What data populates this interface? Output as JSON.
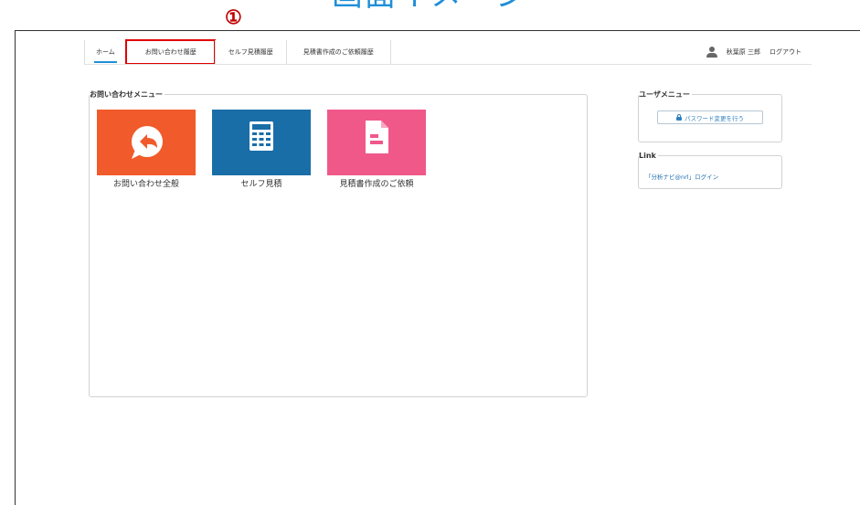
{
  "header": {
    "screen_title": "画面イメージ",
    "annotation_number": "①"
  },
  "nav": {
    "tabs": [
      {
        "label": "ホーム",
        "active": true
      },
      {
        "label": "お問い合わせ履歴",
        "highlighted": true
      },
      {
        "label": "セルフ見積履歴"
      },
      {
        "label": "見積書作成のご依頼履歴"
      }
    ],
    "user_name": "秋葉原 三郎",
    "logout_label": "ログアウト"
  },
  "inquiry_menu": {
    "title": "お問い合わせメニュー",
    "tiles": [
      {
        "label": "お問い合わせ全般",
        "icon": "reply-chat-icon",
        "color": "#f15a2b"
      },
      {
        "label": "セルフ見積",
        "icon": "calculator-icon",
        "color": "#1a6ea8"
      },
      {
        "label": "見積書作成のご依頼",
        "icon": "document-icon",
        "color": "#f0588a"
      }
    ]
  },
  "user_menu": {
    "title": "ユーザメニュー",
    "password_button": "パスワード変更を行う"
  },
  "link_box": {
    "title": "Link",
    "items": [
      "「分析ナビ@nrl」ログイン"
    ]
  },
  "colors": {
    "accent": "#1f8fd8",
    "highlight": "#e00000",
    "link": "#1f6fb0"
  }
}
